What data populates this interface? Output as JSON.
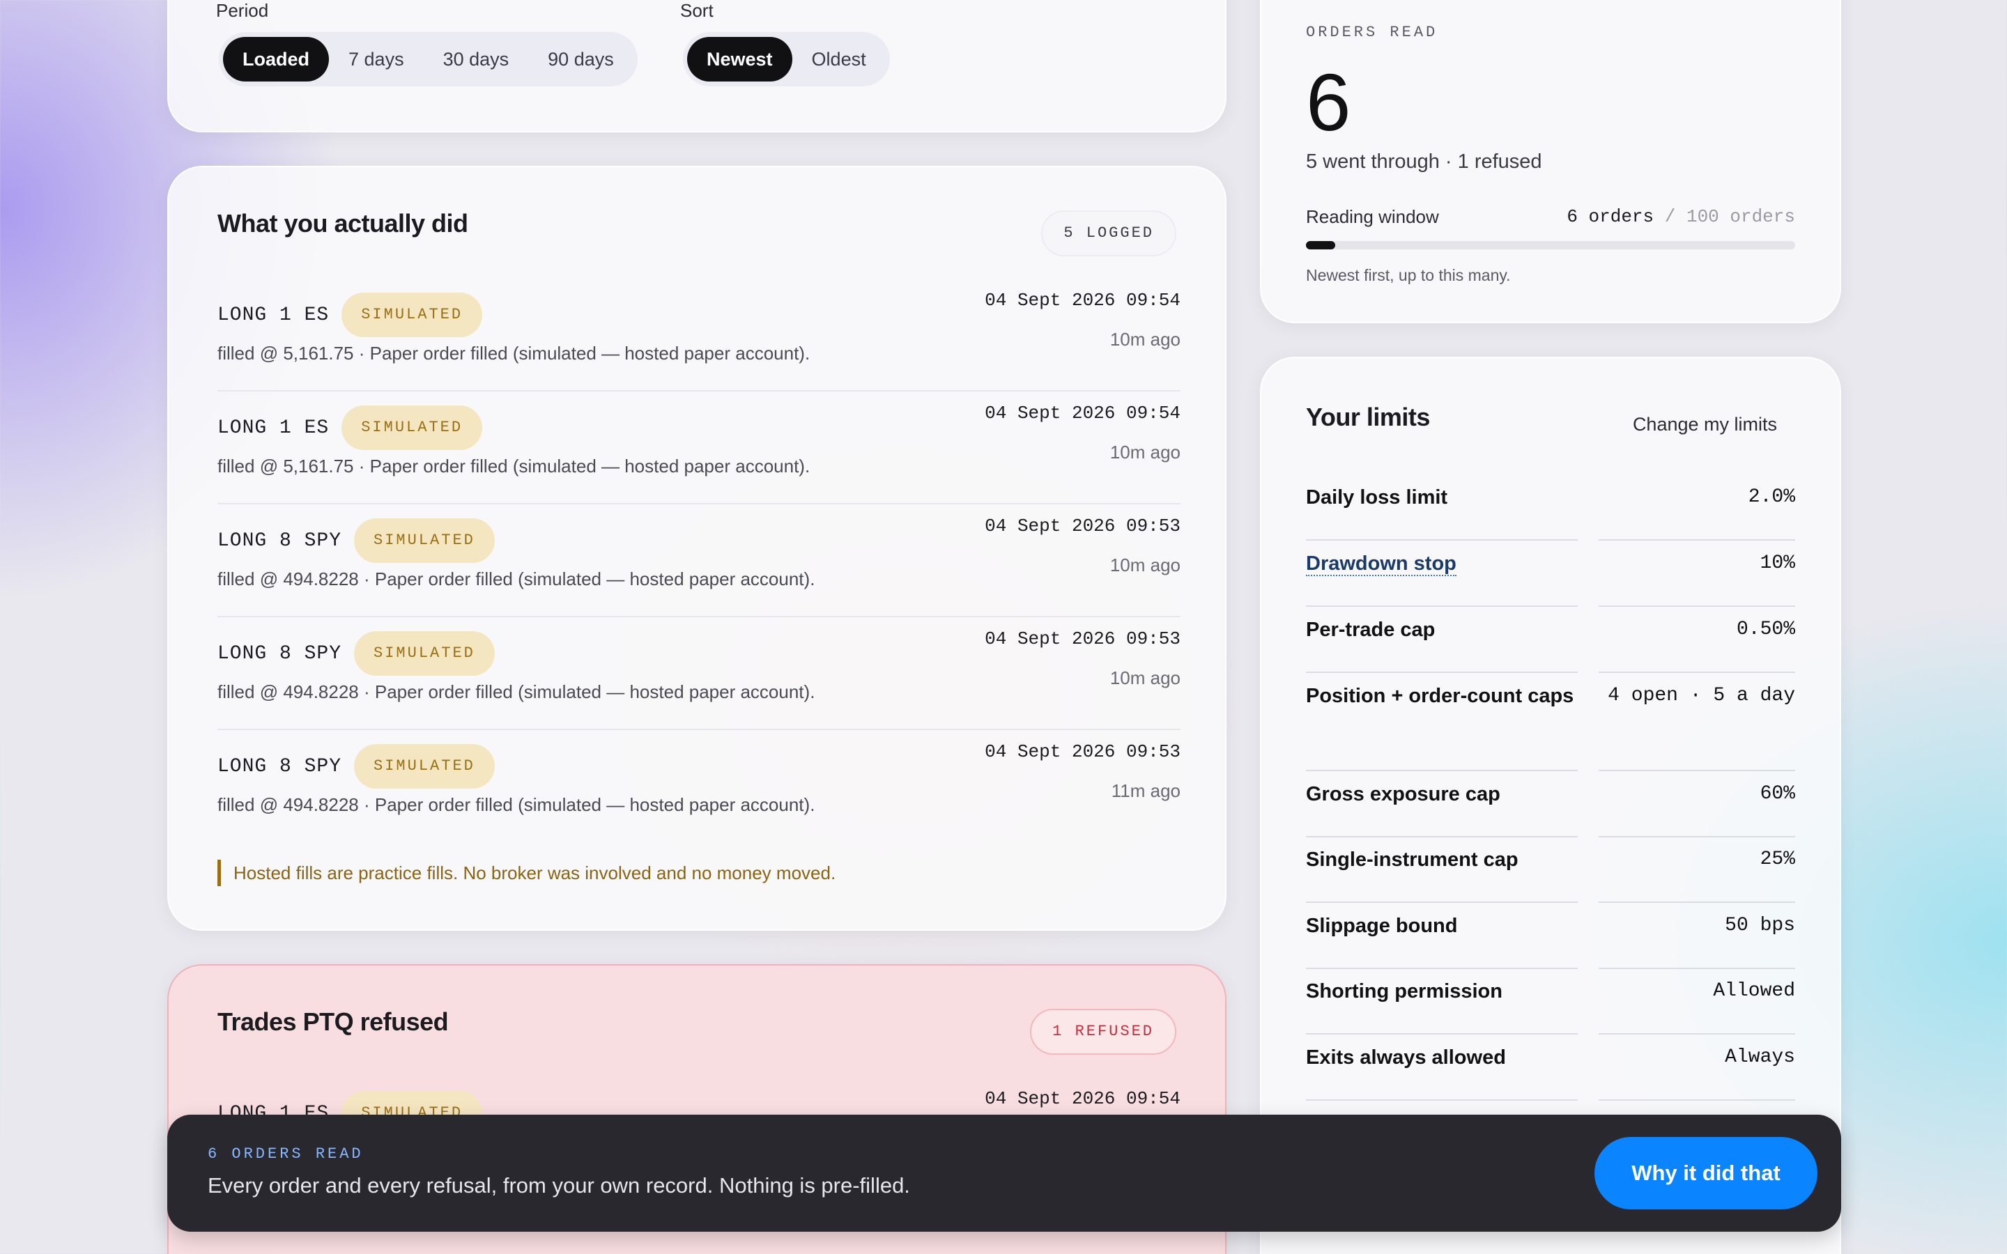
{
  "filters": {
    "period_label": "Period",
    "period_options": [
      "Loaded",
      "7 days",
      "30 days",
      "90 days"
    ],
    "period_selected": "Loaded",
    "sort_label": "Sort",
    "sort_options": [
      "Newest",
      "Oldest"
    ],
    "sort_selected": "Newest"
  },
  "actions": {
    "title": "What you actually did",
    "badge": "5 LOGGED",
    "orders": [
      {
        "order": "LONG 1 ES",
        "status": "SIMULATED",
        "detail": "filled @ 5,161.75 · Paper order filled (simulated — hosted paper account).",
        "timestamp": "04 Sept 2026 09:54",
        "ago": "10m ago"
      },
      {
        "order": "LONG 1 ES",
        "status": "SIMULATED",
        "detail": "filled @ 5,161.75 · Paper order filled (simulated — hosted paper account).",
        "timestamp": "04 Sept 2026 09:54",
        "ago": "10m ago"
      },
      {
        "order": "LONG 8 SPY",
        "status": "SIMULATED",
        "detail": "filled @ 494.8228 · Paper order filled (simulated — hosted paper account).",
        "timestamp": "04 Sept 2026 09:53",
        "ago": "10m ago"
      },
      {
        "order": "LONG 8 SPY",
        "status": "SIMULATED",
        "detail": "filled @ 494.8228 · Paper order filled (simulated — hosted paper account).",
        "timestamp": "04 Sept 2026 09:53",
        "ago": "10m ago"
      },
      {
        "order": "LONG 8 SPY",
        "status": "SIMULATED",
        "detail": "filled @ 494.8228 · Paper order filled (simulated — hosted paper account).",
        "timestamp": "04 Sept 2026 09:53",
        "ago": "11m ago"
      }
    ],
    "notice": "Hosted fills are practice fills. No broker was involved and no money moved."
  },
  "refused": {
    "title": "Trades PTQ refused",
    "badge": "1 REFUSED",
    "orders": [
      {
        "order": "LONG 1 ES",
        "status": "SIMULATED",
        "timestamp": "04 Sept 2026 09:54"
      }
    ]
  },
  "orders_read": {
    "eyebrow": "ORDERS READ",
    "count": "6",
    "summary": "5 went through · 1 refused",
    "window_label": "Reading window",
    "window_current": "6 orders",
    "window_separator": "/",
    "window_max": "100 orders",
    "window_fraction": 0.06,
    "window_help": "Newest first, up to this many."
  },
  "limits": {
    "title": "Your limits",
    "change_link": "Change my limits",
    "rows": [
      {
        "name": "Daily loss limit",
        "value": "2.0%"
      },
      {
        "name": "Drawdown stop",
        "value": "10%"
      },
      {
        "name": "Per-trade cap",
        "value": "0.50%"
      },
      {
        "name": "Position + order-count caps",
        "value": "4 open · 5 a day"
      },
      {
        "name": "Gross exposure cap",
        "value": "60%"
      },
      {
        "name": "Single-instrument cap",
        "value": "25%"
      },
      {
        "name": "Slippage bound",
        "value": "50 bps"
      },
      {
        "name": "Shorting permission",
        "value": "Allowed"
      },
      {
        "name": "Exits always allowed",
        "value": "Always"
      }
    ]
  },
  "bottom_bar": {
    "eyebrow": "6 ORDERS READ",
    "text": "Every order and every refusal, from your own record. Nothing is pre-filled.",
    "cta": "Why it did that"
  },
  "colors": {
    "accent": "#0a84ff",
    "simulated_bg": "#f5e6c2",
    "simulated_text": "#9a6f14",
    "refused_text": "#c0303c",
    "active_segment": "#111114"
  }
}
